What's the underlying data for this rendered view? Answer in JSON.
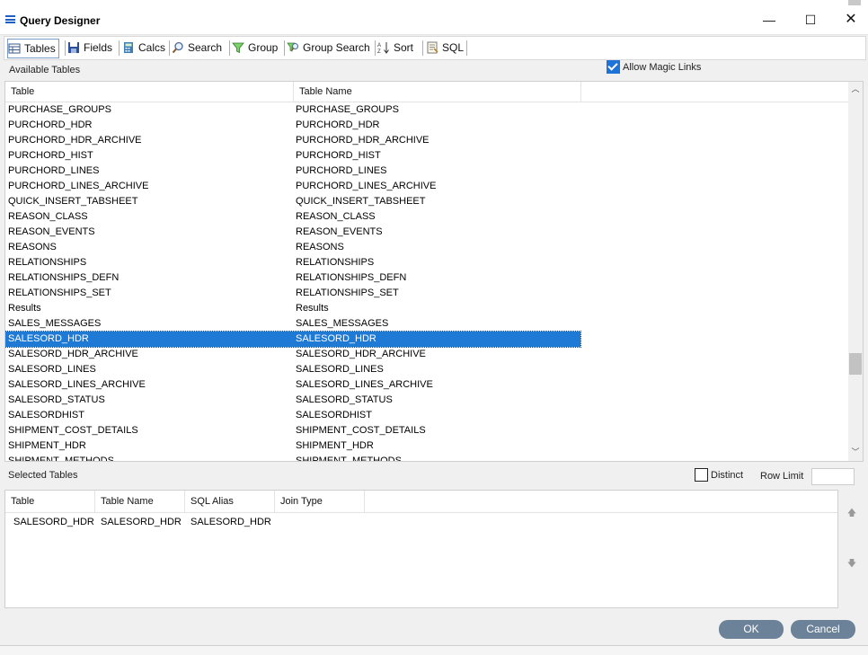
{
  "window": {
    "title": "Query Designer",
    "min_glyph": "—",
    "max_glyph": "☐",
    "close_glyph": "✕"
  },
  "toolbar": {
    "tabs": [
      {
        "label": "Tables",
        "icon": "table-grid-icon",
        "active": true
      },
      {
        "label": "Fields",
        "icon": "save-disk-icon"
      },
      {
        "label": "Calcs",
        "icon": "calculator-icon"
      },
      {
        "label": "Search",
        "icon": "magnifier-icon"
      },
      {
        "label": "Group",
        "icon": "funnel-filter-icon"
      },
      {
        "label": "Group Search",
        "icon": "group-search-icon"
      },
      {
        "label": "Sort",
        "icon": "sort-az-icon"
      },
      {
        "label": "SQL",
        "icon": "sql-document-icon"
      }
    ]
  },
  "available": {
    "label": "Available Tables",
    "allow_magic_links": {
      "label": "Allow Magic Links",
      "checked": true
    },
    "columns": [
      "Table",
      "Table Name"
    ],
    "rows": [
      [
        "PURCHASE_GROUPS",
        "PURCHASE_GROUPS"
      ],
      [
        "PURCHORD_HDR",
        "PURCHORD_HDR"
      ],
      [
        "PURCHORD_HDR_ARCHIVE",
        "PURCHORD_HDR_ARCHIVE"
      ],
      [
        "PURCHORD_HIST",
        "PURCHORD_HIST"
      ],
      [
        "PURCHORD_LINES",
        "PURCHORD_LINES"
      ],
      [
        "PURCHORD_LINES_ARCHIVE",
        "PURCHORD_LINES_ARCHIVE"
      ],
      [
        "QUICK_INSERT_TABSHEET",
        "QUICK_INSERT_TABSHEET"
      ],
      [
        "REASON_CLASS",
        "REASON_CLASS"
      ],
      [
        "REASON_EVENTS",
        "REASON_EVENTS"
      ],
      [
        "REASONS",
        "REASONS"
      ],
      [
        "RELATIONSHIPS",
        "RELATIONSHIPS"
      ],
      [
        "RELATIONSHIPS_DEFN",
        "RELATIONSHIPS_DEFN"
      ],
      [
        "RELATIONSHIPS_SET",
        "RELATIONSHIPS_SET"
      ],
      [
        "Results",
        "Results"
      ],
      [
        "SALES_MESSAGES",
        "SALES_MESSAGES"
      ],
      [
        "SALESORD_HDR",
        "SALESORD_HDR"
      ],
      [
        "SALESORD_HDR_ARCHIVE",
        "SALESORD_HDR_ARCHIVE"
      ],
      [
        "SALESORD_LINES",
        "SALESORD_LINES"
      ],
      [
        "SALESORD_LINES_ARCHIVE",
        "SALESORD_LINES_ARCHIVE"
      ],
      [
        "SALESORD_STATUS",
        "SALESORD_STATUS"
      ],
      [
        "SALESORDHIST",
        "SALESORDHIST"
      ],
      [
        "SHIPMENT_COST_DETAILS",
        "SHIPMENT_COST_DETAILS"
      ],
      [
        "SHIPMENT_HDR",
        "SHIPMENT_HDR"
      ],
      [
        "SHIPMENT_METHODS",
        "SHIPMENT_METHODS"
      ]
    ],
    "selected_row": 15
  },
  "selected": {
    "label": "Selected Tables",
    "distinct": {
      "label": "Distinct",
      "checked": false
    },
    "row_limit_label": "Row Limit",
    "row_limit_value": "",
    "columns": [
      "Table",
      "Table Name",
      "SQL Alias",
      "Join Type"
    ],
    "rows": [
      [
        "SALESORD_HDR",
        "SALESORD_HDR",
        "SALESORD_HDR",
        ""
      ]
    ]
  },
  "buttons": {
    "ok": "OK",
    "cancel": "Cancel"
  },
  "colors": {
    "selection": "#1f7ad6",
    "button": "#6b8299",
    "accent": "#1e73d8"
  }
}
